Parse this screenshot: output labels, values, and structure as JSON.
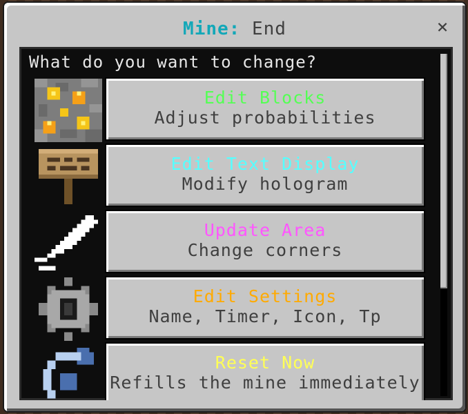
{
  "window": {
    "title_key": "Mine:",
    "title_value": "End",
    "close_label": "×"
  },
  "panel": {
    "prompt": "What do you want to change?"
  },
  "options": [
    {
      "title": "Edit Blocks",
      "subtitle": "Adjust probabilities",
      "color": "#55ff55",
      "icon": "gold-ore-block-icon"
    },
    {
      "title": "Edit Text Display",
      "subtitle": "Modify hologram",
      "color": "#55ffff",
      "icon": "wooden-sign-icon"
    },
    {
      "title": "Update Area",
      "subtitle": "Change corners",
      "color": "#ff55ff",
      "icon": "pencil-icon"
    },
    {
      "title": "Edit Settings",
      "subtitle": "Name, Timer, Icon, Tp",
      "color": "#ffaa00",
      "icon": "gear-icon"
    },
    {
      "title": "Reset Now",
      "subtitle": "Refills the mine immediately",
      "color": "#ffff55",
      "icon": "refresh-icon"
    }
  ],
  "colors": {
    "title_accent": "#13a8b8",
    "window_bg": "#c6c6c6",
    "panel_bg": "#0d0d0d"
  }
}
